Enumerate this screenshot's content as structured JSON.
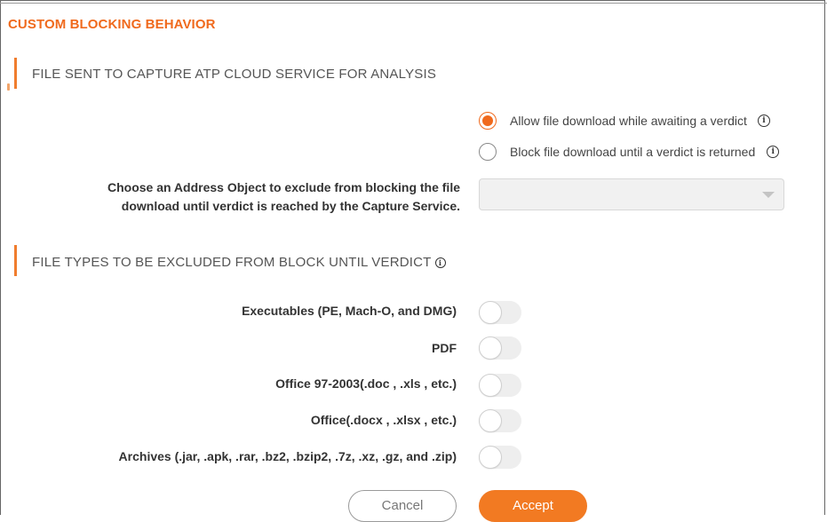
{
  "header": {
    "title": "CUSTOM BLOCKING BEHAVIOR"
  },
  "section_analysis": {
    "title": "FILE SENT TO CAPTURE ATP CLOUD SERVICE FOR ANALYSIS",
    "options": [
      {
        "label": "Allow file download while awaiting a verdict",
        "checked": true,
        "info_icon": "info-icon"
      },
      {
        "label": "Block file download until a verdict is returned",
        "checked": false,
        "info_icon": "info-icon"
      }
    ],
    "address_object": {
      "label": "Choose an Address Object to exclude from blocking the file download until verdict is reached by the Capture Service.",
      "value": ""
    }
  },
  "section_exclusions": {
    "title": "FILE TYPES TO BE EXCLUDED FROM BLOCK UNTIL VERDICT",
    "info_icon": "info-icon",
    "file_types": [
      {
        "label": "Executables (PE, Mach-O, and DMG)",
        "enabled": false
      },
      {
        "label": "PDF",
        "enabled": false
      },
      {
        "label": "Office 97-2003(.doc , .xls , etc.)",
        "enabled": false
      },
      {
        "label": "Office(.docx , .xlsx , etc.)",
        "enabled": false
      },
      {
        "label": "Archives (.jar, .apk, .rar, .bz2, .bzip2, .7z, .xz, .gz, and .zip)",
        "enabled": false
      }
    ]
  },
  "footer": {
    "cancel_label": "Cancel",
    "accept_label": "Accept"
  },
  "colors": {
    "accent": "#f06a1d",
    "accept_button": "#f27a22",
    "toggle_off": "#eeeeee"
  }
}
